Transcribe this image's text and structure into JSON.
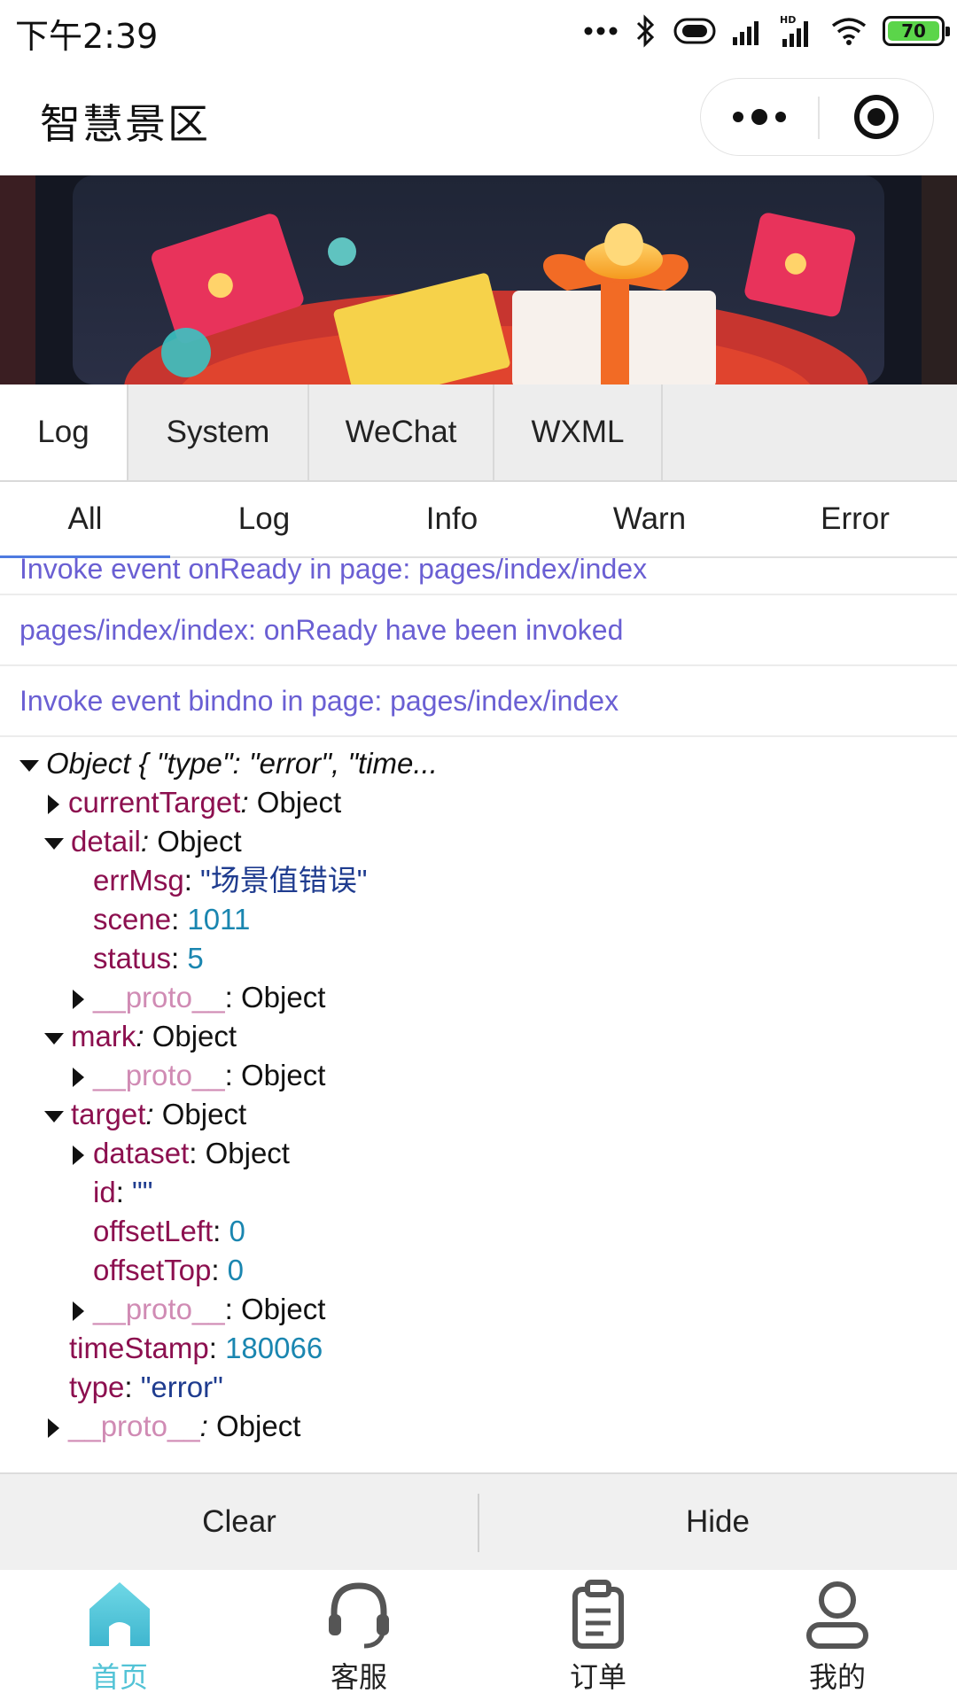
{
  "status_bar": {
    "time": "下午2:39",
    "battery_level": "70",
    "icons": [
      "dots-icon",
      "bluetooth-icon",
      "vibrate-icon",
      "signal-icon",
      "signal-hd-icon",
      "wifi-icon",
      "battery-icon"
    ]
  },
  "nav": {
    "title": "智慧景区",
    "more_icon": "more-dots-icon",
    "close_icon": "target-close-icon"
  },
  "banner": {
    "description_icon": "red-envelope-gift-banner"
  },
  "vconsole": {
    "tabs": [
      {
        "label": "Log",
        "active": true
      },
      {
        "label": "System",
        "active": false
      },
      {
        "label": "WeChat",
        "active": false
      },
      {
        "label": "WXML",
        "active": false
      }
    ],
    "subtabs": [
      {
        "label": "All",
        "active": true
      },
      {
        "label": "Log",
        "active": false
      },
      {
        "label": "Info",
        "active": false
      },
      {
        "label": "Warn",
        "active": false
      },
      {
        "label": "Error",
        "active": false
      }
    ],
    "log_lines": [
      "Invoke event onReady in page: pages/index/index",
      "pages/index/index: onReady have been invoked",
      "Invoke event bindno in page: pages/index/index"
    ],
    "object_summary": "Object { \"type\": \"error\", \"time...",
    "tree": {
      "currentTarget_key": "currentTarget",
      "currentTarget_val": "Object",
      "detail_key": "detail",
      "detail_val": "Object",
      "errMsg_key": "errMsg",
      "errMsg_val": "\"场景值错误\"",
      "scene_key": "scene",
      "scene_val": "1011",
      "status_key": "status",
      "status_val": "5",
      "proto_key": "__proto__",
      "proto_val": "Object",
      "mark_key": "mark",
      "mark_val": "Object",
      "target_key": "target",
      "target_val": "Object",
      "dataset_key": "dataset",
      "dataset_val": "Object",
      "id_key": "id",
      "id_val": "\"\"",
      "offsetLeft_key": "offsetLeft",
      "offsetLeft_val": "0",
      "offsetTop_key": "offsetTop",
      "offsetTop_val": "0",
      "timeStamp_key": "timeStamp",
      "timeStamp_val": "180066",
      "type_key": "type",
      "type_val": "\"error\""
    },
    "toolbar": {
      "clear": "Clear",
      "hide": "Hide"
    }
  },
  "tabbar": {
    "items": [
      {
        "label": "首页",
        "icon": "home-icon",
        "active": true
      },
      {
        "label": "客服",
        "icon": "headset-icon",
        "active": false
      },
      {
        "label": "订单",
        "icon": "clipboard-icon",
        "active": false
      },
      {
        "label": "我的",
        "icon": "user-icon",
        "active": false
      }
    ],
    "active_color": "#52c3d6"
  }
}
